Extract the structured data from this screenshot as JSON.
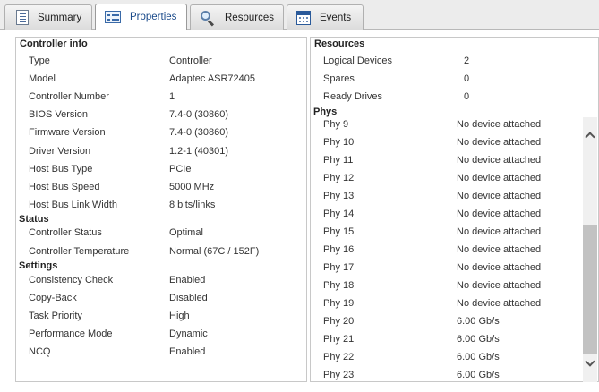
{
  "tabs": [
    {
      "label": "Summary",
      "icon": "document-icon"
    },
    {
      "label": "Properties",
      "icon": "properties-icon",
      "active": true
    },
    {
      "label": "Resources",
      "icon": "search-icon"
    },
    {
      "label": "Events",
      "icon": "calendar-icon"
    }
  ],
  "controller_info": {
    "title": "Controller info",
    "rows": [
      {
        "key": "Type",
        "value": "Controller"
      },
      {
        "key": "Model",
        "value": "Adaptec ASR72405"
      },
      {
        "key": "Controller Number",
        "value": "1"
      },
      {
        "key": "BIOS Version",
        "value": "7.4-0 (30860)"
      },
      {
        "key": "Firmware Version",
        "value": "7.4-0 (30860)"
      },
      {
        "key": "Driver Version",
        "value": "1.2-1 (40301)"
      },
      {
        "key": "Host Bus Type",
        "value": "PCIe"
      },
      {
        "key": "Host Bus Speed",
        "value": "5000 MHz"
      },
      {
        "key": "Host Bus Link Width",
        "value": "8 bits/links"
      }
    ]
  },
  "status": {
    "title": "Status",
    "rows": [
      {
        "key": "Controller Status",
        "value": "Optimal"
      },
      {
        "key": "Controller Temperature",
        "value": "Normal (67C / 152F)"
      }
    ]
  },
  "settings": {
    "title": "Settings",
    "rows": [
      {
        "key": "Consistency Check",
        "value": "Enabled"
      },
      {
        "key": "Copy-Back",
        "value": "Disabled"
      },
      {
        "key": "Task Priority",
        "value": "High"
      },
      {
        "key": "Performance Mode",
        "value": "Dynamic"
      },
      {
        "key": "NCQ",
        "value": "Enabled"
      }
    ]
  },
  "resources": {
    "title": "Resources",
    "rows": [
      {
        "key": "Logical Devices",
        "value": "2"
      },
      {
        "key": "Spares",
        "value": "0"
      },
      {
        "key": "Ready Drives",
        "value": "0"
      }
    ]
  },
  "phys": {
    "title": "Phys",
    "rows": [
      {
        "key": "Phy 9",
        "value": "No device attached"
      },
      {
        "key": "Phy 10",
        "value": "No device attached"
      },
      {
        "key": "Phy 11",
        "value": "No device attached"
      },
      {
        "key": "Phy 12",
        "value": "No device attached"
      },
      {
        "key": "Phy 13",
        "value": "No device attached"
      },
      {
        "key": "Phy 14",
        "value": "No device attached"
      },
      {
        "key": "Phy 15",
        "value": "No device attached"
      },
      {
        "key": "Phy 16",
        "value": "No device attached"
      },
      {
        "key": "Phy 17",
        "value": "No device attached"
      },
      {
        "key": "Phy 18",
        "value": "No device attached"
      },
      {
        "key": "Phy 19",
        "value": "No device attached"
      },
      {
        "key": "Phy 20",
        "value": "6.00 Gb/s"
      },
      {
        "key": "Phy 21",
        "value": "6.00 Gb/s"
      },
      {
        "key": "Phy 22",
        "value": "6.00 Gb/s"
      },
      {
        "key": "Phy 23",
        "value": "6.00 Gb/s"
      }
    ]
  }
}
